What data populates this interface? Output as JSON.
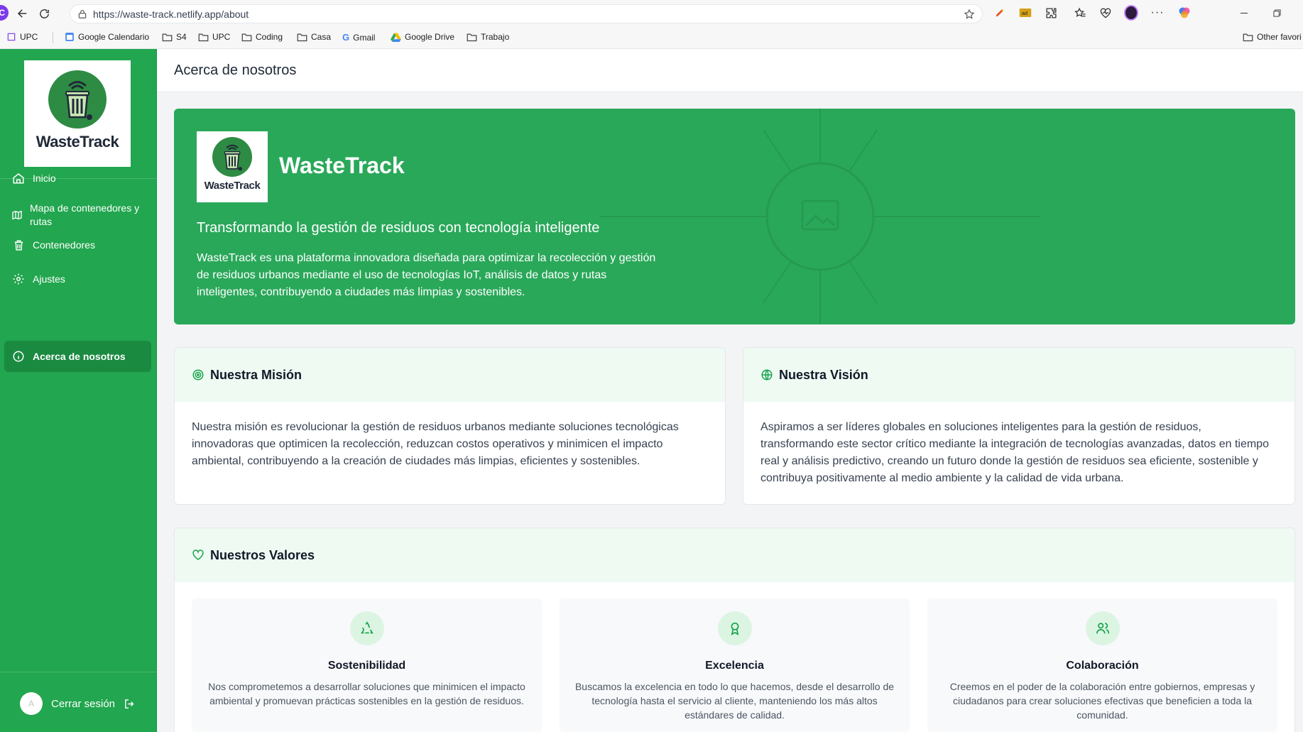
{
  "browser": {
    "profile_initial": "C",
    "url": "https://waste-track.netlify.app/about",
    "bookmarks": [
      {
        "label": "UPC"
      },
      {
        "label": "Google Calendario"
      },
      {
        "label": "S4"
      },
      {
        "label": "UPC"
      },
      {
        "label": "Coding"
      },
      {
        "label": "Casa"
      },
      {
        "label": "Gmail"
      },
      {
        "label": "Google Drive"
      },
      {
        "label": "Trabajo"
      }
    ],
    "other_favorites": "Other favori"
  },
  "sidebar": {
    "logo_text": "WasteTrack",
    "items": [
      {
        "label": "Inicio",
        "icon": "home-icon"
      },
      {
        "label": "Mapa de contenedores y rutas",
        "icon": "map-icon"
      },
      {
        "label": "Contenedores",
        "icon": "trash-icon"
      },
      {
        "label": "Ajustes",
        "icon": "gear-icon"
      },
      {
        "label": "Acerca de nosotros",
        "icon": "info-icon",
        "active": true
      }
    ],
    "avatar_initial": "A",
    "logout_label": "Cerrar sesión"
  },
  "header": {
    "title": "Acerca de nosotros"
  },
  "hero": {
    "logo_text": "WasteTrack",
    "title": "WasteTrack",
    "subtitle": "Transformando la gestión de residuos con tecnología inteligente",
    "description": "WasteTrack es una plataforma innovadora diseñada para optimizar la recolección y gestión de residuos urbanos mediante el uso de tecnologías IoT, análisis de datos y rutas inteligentes, contribuyendo a ciudades más limpias y sostenibles."
  },
  "mission": {
    "title": "Nuestra Misión",
    "text": "Nuestra misión es revolucionar la gestión de residuos urbanos mediante soluciones tecnológicas innovadoras que optimicen la recolección, reduzcan costos operativos y minimicen el impacto ambiental, contribuyendo a la creación de ciudades más limpias, eficientes y sostenibles."
  },
  "vision": {
    "title": "Nuestra Visión",
    "text": "Aspiramos a ser líderes globales en soluciones inteligentes para la gestión de residuos, transformando este sector crítico mediante la integración de tecnologías avanzadas, datos en tiempo real y análisis predictivo, creando un futuro donde la gestión de residuos sea eficiente, sostenible y contribuya positivamente al medio ambiente y la calidad de vida urbana."
  },
  "values": {
    "title": "Nuestros Valores",
    "items": [
      {
        "title": "Sostenibilidad",
        "icon": "recycle-icon",
        "text": "Nos comprometemos a desarrollar soluciones que minimicen el impacto ambiental y promuevan prácticas sostenibles en la gestión de residuos."
      },
      {
        "title": "Excelencia",
        "icon": "award-icon",
        "text": "Buscamos la excelencia en todo lo que hacemos, desde el desarrollo de tecnología hasta el servicio al cliente, manteniendo los más altos estándares de calidad."
      },
      {
        "title": "Colaboración",
        "icon": "users-icon",
        "text": "Creemos en el poder de la colaboración entre gobiernos, empresas y ciudadanos para crear soluciones efectivas que beneficien a toda la comunidad."
      }
    ]
  },
  "colors": {
    "primary_green": "#22a64f",
    "hero_green": "#2aa85a",
    "card_header_tint": "#effaf3"
  }
}
